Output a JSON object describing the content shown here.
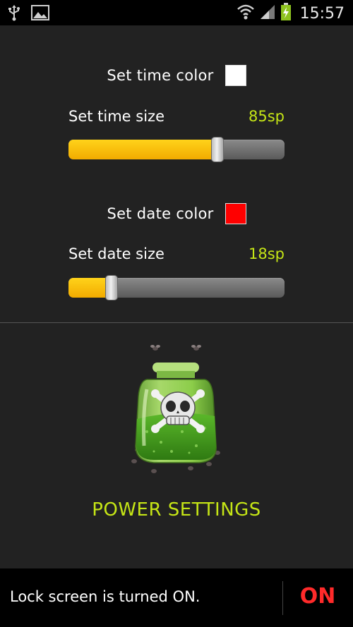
{
  "status_bar": {
    "time": "15:57",
    "icons": [
      "usb-icon",
      "image-icon",
      "wifi-icon",
      "signal-icon",
      "battery-charging-icon"
    ]
  },
  "time_color": {
    "label": "Set time color",
    "color": "#ffffff"
  },
  "time_size": {
    "label": "Set time size",
    "value_text": "85sp",
    "fraction": 0.7
  },
  "date_color": {
    "label": "Set date color",
    "color": "#ff0000"
  },
  "date_size": {
    "label": "Set date size",
    "value_text": "18sp",
    "fraction": 0.18
  },
  "power": {
    "title": "POWER SETTINGS",
    "icon": "poison-jar-icon"
  },
  "lock_bar": {
    "message": "Lock screen is turned ON.",
    "toggle_label": "ON"
  },
  "colors": {
    "accent": "#c5e516",
    "slider_fill": "#f7b800",
    "toggle_on": "#ff2a2a",
    "background": "#222222"
  }
}
